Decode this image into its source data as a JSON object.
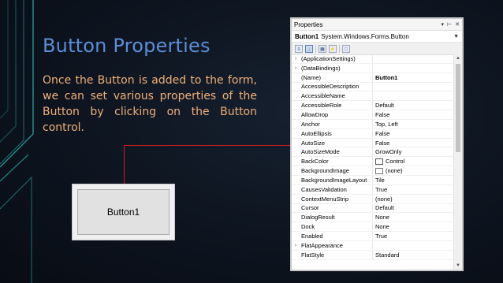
{
  "slide": {
    "title": "Button Properties",
    "body": "Once the Button is added to the form, we can set various properties of the Button by clicking on the Button control."
  },
  "button_preview": {
    "label": "Button1"
  },
  "properties_window": {
    "title": "Properties",
    "title_controls": [
      "pin-icon",
      "dock-icon",
      "close-icon"
    ],
    "object_name": "Button1",
    "object_type": "System.Windows.Forms.Button",
    "toolbar": [
      "categorized-icon",
      "alphabetical-icon",
      "properties-icon",
      "events-icon",
      "property-pages-icon"
    ],
    "rows": [
      {
        "name": "(ApplicationSettings)",
        "value": "",
        "expand": true
      },
      {
        "name": "(DataBindings)",
        "value": "",
        "expand": true
      },
      {
        "name": "(Name)",
        "value": "Button1",
        "bold": true
      },
      {
        "name": "AccessibleDescription",
        "value": ""
      },
      {
        "name": "AccessibleName",
        "value": ""
      },
      {
        "name": "AccessibleRole",
        "value": "Default"
      },
      {
        "name": "AllowDrop",
        "value": "False"
      },
      {
        "name": "Anchor",
        "value": "Top, Left"
      },
      {
        "name": "AutoEllipsis",
        "value": "False"
      },
      {
        "name": "AutoSize",
        "value": "False"
      },
      {
        "name": "AutoSizeMode",
        "value": "GrowOnly"
      },
      {
        "name": "BackColor",
        "value": "Control",
        "swatch": "color"
      },
      {
        "name": "BackgroundImage",
        "value": "(none)",
        "swatch": "image"
      },
      {
        "name": "BackgroundImageLayout",
        "value": "Tile"
      },
      {
        "name": "CausesValidation",
        "value": "True"
      },
      {
        "name": "ContextMenuStrip",
        "value": "(none)"
      },
      {
        "name": "Cursor",
        "value": "Default"
      },
      {
        "name": "DialogResult",
        "value": "None"
      },
      {
        "name": "Dock",
        "value": "None"
      },
      {
        "name": "Enabled",
        "value": "True"
      },
      {
        "name": "FlatAppearance",
        "value": "",
        "expand": true
      },
      {
        "name": "FlatStyle",
        "value": "Standard"
      }
    ]
  },
  "colors": {
    "title": "#5b8ed6",
    "body_text": "#f0b079",
    "connector": "#d01c1c",
    "background": "#0d141f",
    "decor_lines": "#1f8f8a"
  }
}
